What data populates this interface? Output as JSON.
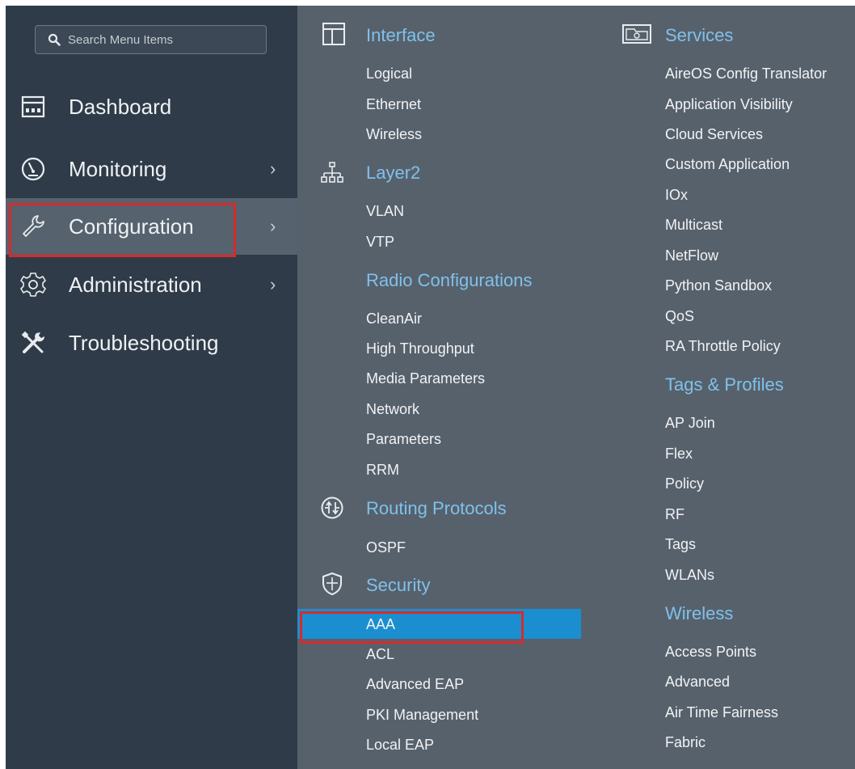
{
  "search": {
    "placeholder": "Search Menu Items"
  },
  "sidebar": {
    "items": [
      {
        "label": "Dashboard",
        "icon": "dashboard-icon",
        "has_submenu": false
      },
      {
        "label": "Monitoring",
        "icon": "gauge-icon",
        "has_submenu": true
      },
      {
        "label": "Configuration",
        "icon": "wrench-icon",
        "has_submenu": true,
        "active": true
      },
      {
        "label": "Administration",
        "icon": "gear-icon",
        "has_submenu": true
      },
      {
        "label": "Troubleshooting",
        "icon": "tools-icon",
        "has_submenu": false
      }
    ],
    "chevron": "›"
  },
  "menu": {
    "interface": {
      "title": "Interface",
      "icon": "interface-icon",
      "items": [
        "Logical",
        "Ethernet",
        "Wireless"
      ]
    },
    "layer2": {
      "title": "Layer2",
      "icon": "network-tree-icon",
      "items": [
        "VLAN",
        "VTP"
      ]
    },
    "radio": {
      "title": "Radio Configurations",
      "items": [
        "CleanAir",
        "High Throughput",
        "Media Parameters",
        "Network",
        "Parameters",
        "RRM"
      ]
    },
    "routing": {
      "title": "Routing Protocols",
      "icon": "router-icon",
      "items": [
        "OSPF"
      ]
    },
    "security": {
      "title": "Security",
      "icon": "shield-icon",
      "items": [
        "AAA",
        "ACL",
        "Advanced EAP",
        "PKI Management",
        "Local EAP"
      ],
      "selected": "AAA"
    },
    "services": {
      "title": "Services",
      "icon": "services-icon",
      "items": [
        "AireOS Config Translator",
        "Application Visibility",
        "Cloud Services",
        "Custom Application",
        "IOx",
        "Multicast",
        "NetFlow",
        "Python Sandbox",
        "QoS",
        "RA Throttle Policy"
      ]
    },
    "tags": {
      "title": "Tags & Profiles",
      "items": [
        "AP Join",
        "Flex",
        "Policy",
        "RF",
        "Tags",
        "WLANs"
      ]
    },
    "wireless": {
      "title": "Wireless",
      "items": [
        "Access Points",
        "Advanced",
        "Air Time Fairness",
        "Fabric"
      ]
    }
  },
  "colors": {
    "sidebar_bg": "#2f3b48",
    "menu_bg": "#57616c",
    "section_title": "#7fc1ea",
    "selected_bg": "#1b8ed0",
    "highlight_border": "#d62b2b"
  }
}
